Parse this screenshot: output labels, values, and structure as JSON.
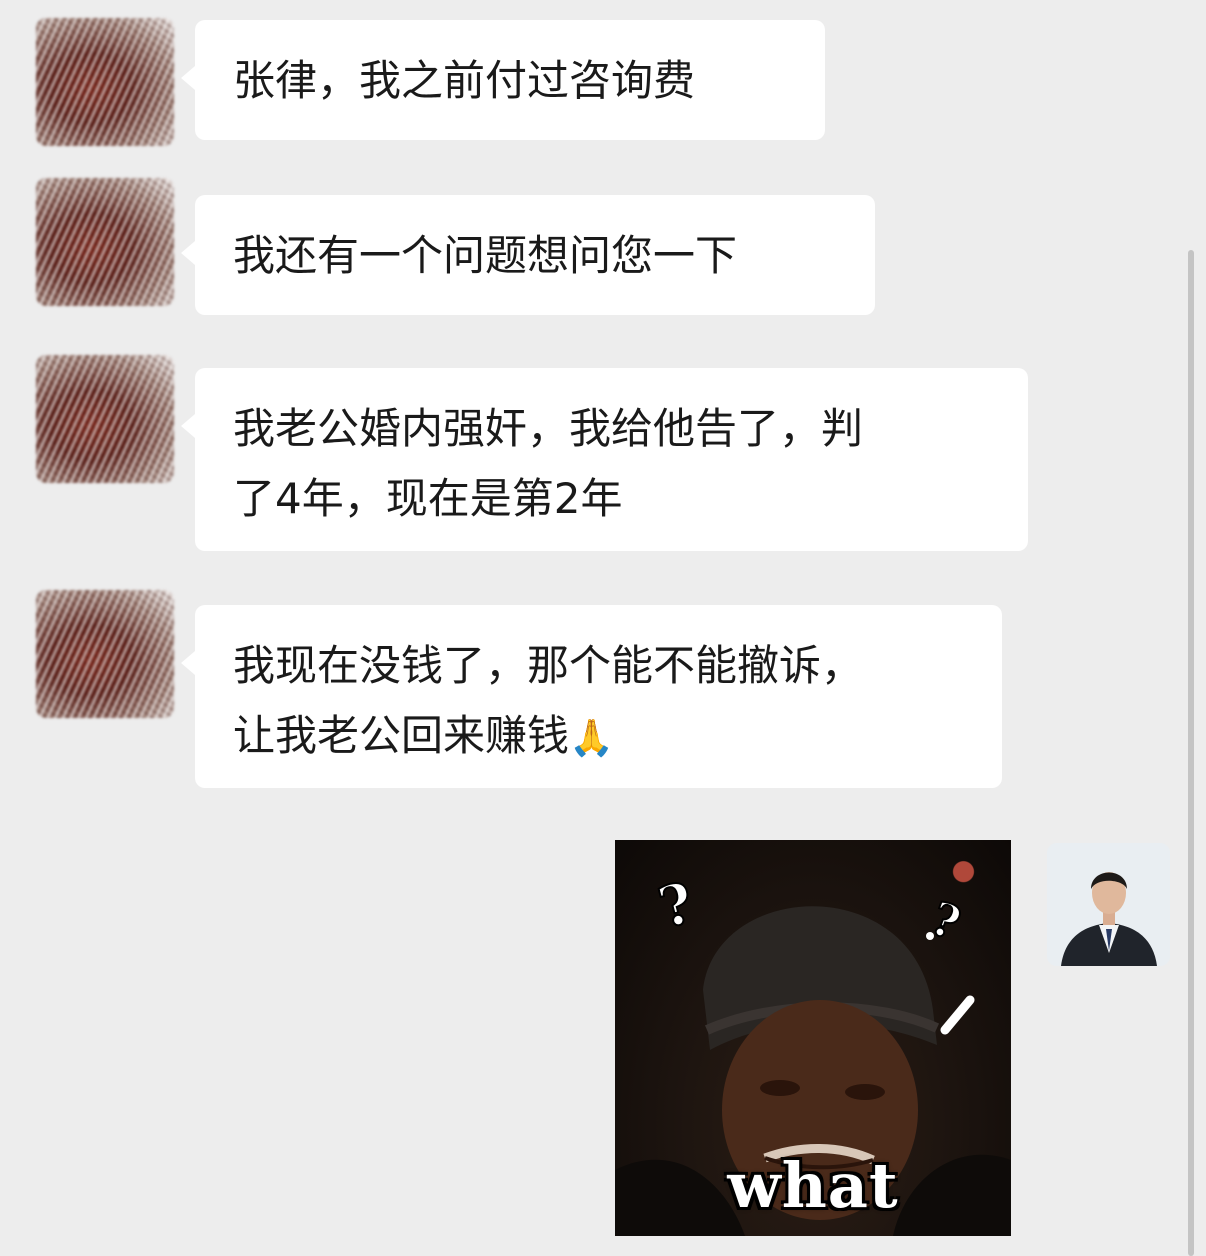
{
  "messages": [
    {
      "sender": "client",
      "lines": [
        "张律，我之前付过咨询费"
      ]
    },
    {
      "sender": "client",
      "lines": [
        "我还有一个问题想问您一下"
      ]
    },
    {
      "sender": "client",
      "lines": [
        "我老公婚内强奸，我给他告了，判",
        "了4年，现在是第2年"
      ]
    },
    {
      "sender": "client",
      "lines": [
        "我现在没钱了，那个能不能撤诉，",
        "让我老公回来赚钱"
      ],
      "emoji": "🙏"
    },
    {
      "sender": "lawyer",
      "type": "sticker",
      "caption": "what"
    }
  ],
  "icons": {
    "client_avatar": "blurred-avatar",
    "lawyer_avatar": "man-in-suit-avatar",
    "emoji": "folded-hands-icon"
  },
  "colors": {
    "background": "#ededed",
    "bubble": "#ffffff",
    "text": "#1a1a1a"
  }
}
